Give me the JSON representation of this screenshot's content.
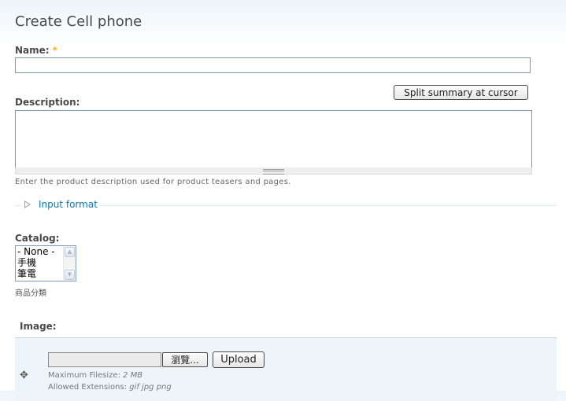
{
  "page": {
    "title": "Create Cell phone"
  },
  "name_field": {
    "label": "Name:",
    "required_mark": "*",
    "value": ""
  },
  "description": {
    "label": "Description:",
    "split_button": "Split summary at cursor",
    "value": "",
    "help": "Enter the product description used for product teasers and pages."
  },
  "input_format": {
    "legend": "Input format"
  },
  "catalog": {
    "label": "Catalog:",
    "options": [
      "- None -",
      "手機",
      "筆電"
    ],
    "help": "商品分類"
  },
  "image": {
    "label": "Image:",
    "browse_button": "瀏覽...",
    "upload_button": "Upload",
    "max_filesize_label": "Maximum Filesize:",
    "max_filesize_value": "2 MB",
    "allowed_ext_label": "Allowed Extensions:",
    "allowed_ext_value": "gif jpg png"
  },
  "colors": {
    "link": "#027ac6",
    "required": "#ffae00",
    "fieldset_bg": "#edf5fa"
  }
}
